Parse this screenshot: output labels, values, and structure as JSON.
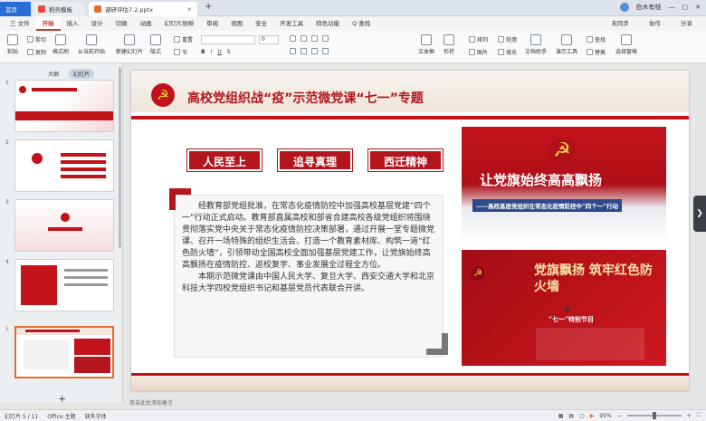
{
  "titlebar": {
    "home_tab": "首页",
    "tab1": "稻壳模板",
    "tab2": "调研评估7.2.pptx",
    "user": "伯木有枝"
  },
  "menu": {
    "file": "三 文件",
    "items": [
      "开始",
      "插入",
      "设计",
      "切换",
      "动画",
      "幻灯片放映",
      "审阅",
      "视图",
      "安全",
      "开发工具",
      "特色功能"
    ],
    "search": "Q 查找",
    "right": [
      "未同步",
      "协作",
      "分享"
    ]
  },
  "ribbon": {
    "paste": "粘贴",
    "cut": "剪切",
    "copy": "复制",
    "format": "格式刷",
    "from_start": "从当前开始",
    "new_slide": "新建幻灯片",
    "layout": "版式",
    "section": "节",
    "reset": "重置",
    "font_size": "0",
    "text_box": "文本框",
    "shapes": "形状",
    "arrange": "排列",
    "outline": "轮廓",
    "picture": "图片",
    "fill": "填充",
    "text_tools": "文档助手",
    "find": "查找",
    "replace": "替换",
    "select": "选择窗格",
    "textbox2": "演示工具"
  },
  "leftpane": {
    "tab_outline": "大纲",
    "tab_slides": "幻灯片",
    "slides": [
      "1",
      "2",
      "3",
      "4",
      "5"
    ]
  },
  "slide": {
    "title": "高校党组织战“疫”示范微党课“七一”专题",
    "keywords": [
      "人民至上",
      "追寻真理",
      "西迁精神"
    ],
    "para1": "经教育部党组批准，在常态化疫情防控中加强高校基层党建“四个一”行动正式启动。教育部直属高校和部省合建高校各级党组织将围绕贯彻落实党中央关于常态化疫情防控决策部署，通过开展一堂专题微党课、召开一场特殊的组织生活会、打造一个教育素材库、构筑一道“红色防火墙”，引领带动全国高校全面加强基层党建工作，让党旗始终高高飘扬在疫情防控、返校复学、事业发展全过程全方位。",
    "para2": "本期示范微党课由中国人民大学、复旦大学、西安交通大学和北京科技大学四校党组织书记和基层党员代表联合开讲。",
    "img1_text": "让党旗始终高高飘扬",
    "img1_sub": "——高校基层党组织在常态化疫情防控中“四个一”行动",
    "img2_text": "党旗飘扬 筑牢红色防火墙",
    "img2_sub": "“七一”特别节目"
  },
  "notes": "单击此处添加备注",
  "status": {
    "slide": "幻灯片 5 / 11",
    "theme": "Office 主题",
    "font": "缺失字体",
    "zoom": "95%"
  }
}
